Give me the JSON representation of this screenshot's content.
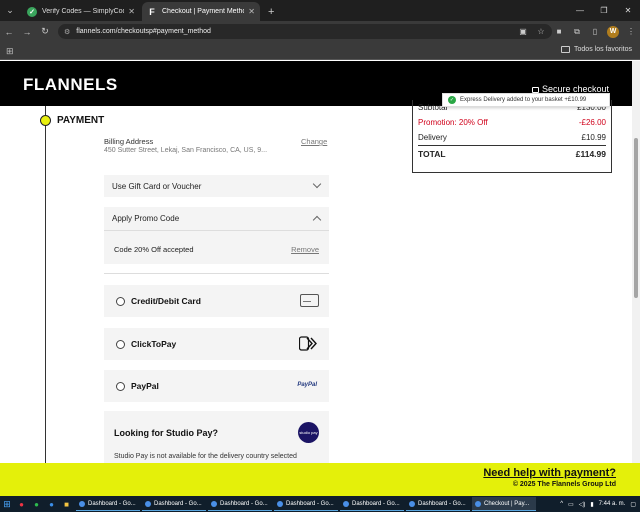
{
  "browser": {
    "tabs": [
      {
        "title": "Verify Codes — SimplyCodes",
        "active": false
      },
      {
        "title": "Checkout | Payment Methods",
        "active": true
      }
    ],
    "url": "flannels.com/checkoutsp#payment_method",
    "bookmarks_all": "Todos los favoritos",
    "profile_initial": "W"
  },
  "header": {
    "logo": "FLANNELS",
    "secure": "Secure checkout"
  },
  "toast": {
    "message": "Express Delivery added to your basket +£10.99"
  },
  "summary": {
    "subtotal_label": "Subtotal",
    "subtotal_value": "£130.00",
    "promo_label": "Promotion: 20% Off",
    "promo_value": "-£26.00",
    "delivery_label": "Delivery",
    "delivery_value": "£10.99",
    "total_label": "TOTAL",
    "total_value": "£114.99",
    "promo_color": "#d0021b"
  },
  "payment": {
    "title": "PAYMENT",
    "billing_label": "Billing Address",
    "billing_address": "450 Sutter Street, Lekaj, San Francisco, CA, US, 9...",
    "change_label": "Change",
    "gift_card_label": "Use Gift Card or Voucher",
    "promo_code_label": "Apply Promo Code",
    "promo_applied": "Code 20% Off accepted",
    "remove_label": "Remove",
    "methods": [
      {
        "label": "Credit/Debit Card",
        "icon": "credit-card-icon"
      },
      {
        "label": "ClickToPay",
        "icon": "clicktopay-icon"
      },
      {
        "label": "PayPal",
        "icon": "paypal-icon"
      }
    ],
    "paypal_logo": "PayPal",
    "studio_title": "Looking for Studio Pay?",
    "studio_note": "Studio Pay is not available for the delivery country selected",
    "studio_logo": "studio pay"
  },
  "footer": {
    "help": "Need help with payment?",
    "copyright": "© 2025 The Flannels Group Ltd",
    "background": "#e4f00a"
  },
  "taskbar": {
    "items": [
      "Dashboard - Go...",
      "Dashboard - Go...",
      "Dashboard - Go...",
      "Dashboard - Go...",
      "Dashboard - Go...",
      "Dashboard - Go...",
      "Checkout | Pay..."
    ],
    "time": "7:44 a. m."
  }
}
